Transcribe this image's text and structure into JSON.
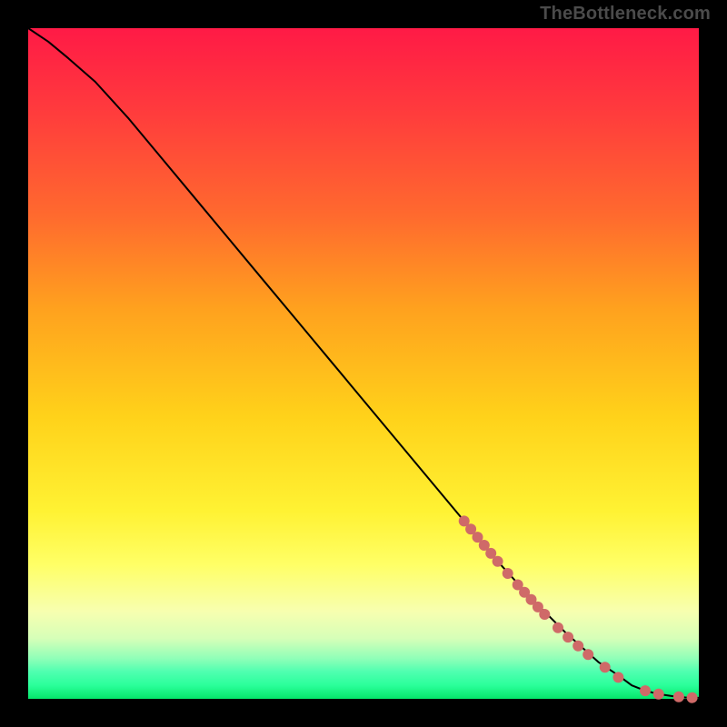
{
  "watermark": "TheBottleneck.com",
  "colors": {
    "background": "#000000",
    "watermark_text": "#4b4b4b",
    "curve_stroke": "#000000",
    "dot_fill": "#cf6a68",
    "gradient_stops": [
      "#ff1a46",
      "#ff3a3d",
      "#ff6a2e",
      "#ffa21e",
      "#ffd21a",
      "#fff233",
      "#ffff66",
      "#f7ffb0",
      "#d6ffb8",
      "#8fffb8",
      "#4effb0",
      "#2aff9a",
      "#05e66a"
    ]
  },
  "chart_data": {
    "type": "line",
    "title": "",
    "xlabel": "",
    "ylabel": "",
    "xlim": [
      0,
      100
    ],
    "ylim": [
      0,
      100
    ],
    "grid": false,
    "series": [
      {
        "name": "curve",
        "x": [
          0,
          3,
          6,
          10,
          15,
          20,
          25,
          30,
          35,
          40,
          45,
          50,
          55,
          60,
          65,
          70,
          75,
          80,
          85,
          88,
          90,
          92,
          94,
          96,
          98,
          100
        ],
        "y": [
          100,
          98,
          95.5,
          92,
          86.5,
          80.5,
          74.5,
          68.5,
          62.5,
          56.5,
          50.5,
          44.5,
          38.5,
          32.5,
          26.5,
          20.5,
          15,
          10,
          5.5,
          3.5,
          2,
          1.2,
          0.7,
          0.4,
          0.2,
          0.15
        ]
      }
    ],
    "markers": {
      "name": "dots-on-curve",
      "points": [
        {
          "x": 65,
          "y": 26.5
        },
        {
          "x": 66,
          "y": 25.3
        },
        {
          "x": 67,
          "y": 24.1
        },
        {
          "x": 68,
          "y": 22.9
        },
        {
          "x": 69,
          "y": 21.7
        },
        {
          "x": 70,
          "y": 20.5
        },
        {
          "x": 71.5,
          "y": 18.7
        },
        {
          "x": 73,
          "y": 17.0
        },
        {
          "x": 74,
          "y": 15.9
        },
        {
          "x": 75,
          "y": 14.8
        },
        {
          "x": 76,
          "y": 13.7
        },
        {
          "x": 77,
          "y": 12.6
        },
        {
          "x": 79,
          "y": 10.6
        },
        {
          "x": 80.5,
          "y": 9.2
        },
        {
          "x": 82,
          "y": 7.9
        },
        {
          "x": 83.5,
          "y": 6.6
        },
        {
          "x": 86,
          "y": 4.7
        },
        {
          "x": 88,
          "y": 3.2
        },
        {
          "x": 92,
          "y": 1.2
        },
        {
          "x": 94,
          "y": 0.7
        },
        {
          "x": 97,
          "y": 0.3
        },
        {
          "x": 99,
          "y": 0.18
        }
      ]
    }
  }
}
